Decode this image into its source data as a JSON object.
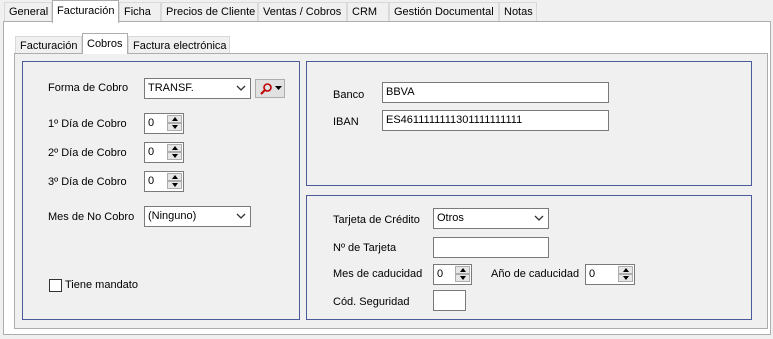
{
  "main_tabs": [
    "General",
    "Facturación",
    "Ficha",
    "Precios de Cliente",
    "Ventas / Cobros",
    "CRM",
    "Gestión Documental",
    "Notas"
  ],
  "sub_tabs": [
    "Facturación",
    "Cobros",
    "Factura electrónica"
  ],
  "cobros": {
    "forma_cobro_label": "Forma de Cobro",
    "forma_cobro_value": "TRANSF.",
    "dia1_label": "1º Día de Cobro",
    "dia1_value": "0",
    "dia2_label": "2º Día de Cobro",
    "dia2_value": "0",
    "dia3_label": "3º Día de Cobro",
    "dia3_value": "0",
    "mes_no_cobro_label": "Mes de No Cobro",
    "mes_no_cobro_value": "(Ninguno)",
    "mandato_label": "Tiene mandato"
  },
  "banco": {
    "banco_label": "Banco",
    "banco_value": "BBVA",
    "iban_label": "IBAN",
    "iban_value": "ES4611111111301111111111"
  },
  "tarjeta": {
    "tipo_label": "Tarjeta de Crédito",
    "tipo_value": "Otros",
    "numero_label": "Nº de Tarjeta",
    "numero_value": "",
    "mes_label": "Mes de caducidad",
    "mes_value": "0",
    "anio_label": "Año de caducidad",
    "anio_value": "0",
    "cod_label": "Cód. Seguridad",
    "cod_value": ""
  },
  "colors": {
    "panel_border": "#4a5a9a",
    "window_bg": "#f0f0f0"
  },
  "icons": {
    "search": "magnifier-icon"
  }
}
